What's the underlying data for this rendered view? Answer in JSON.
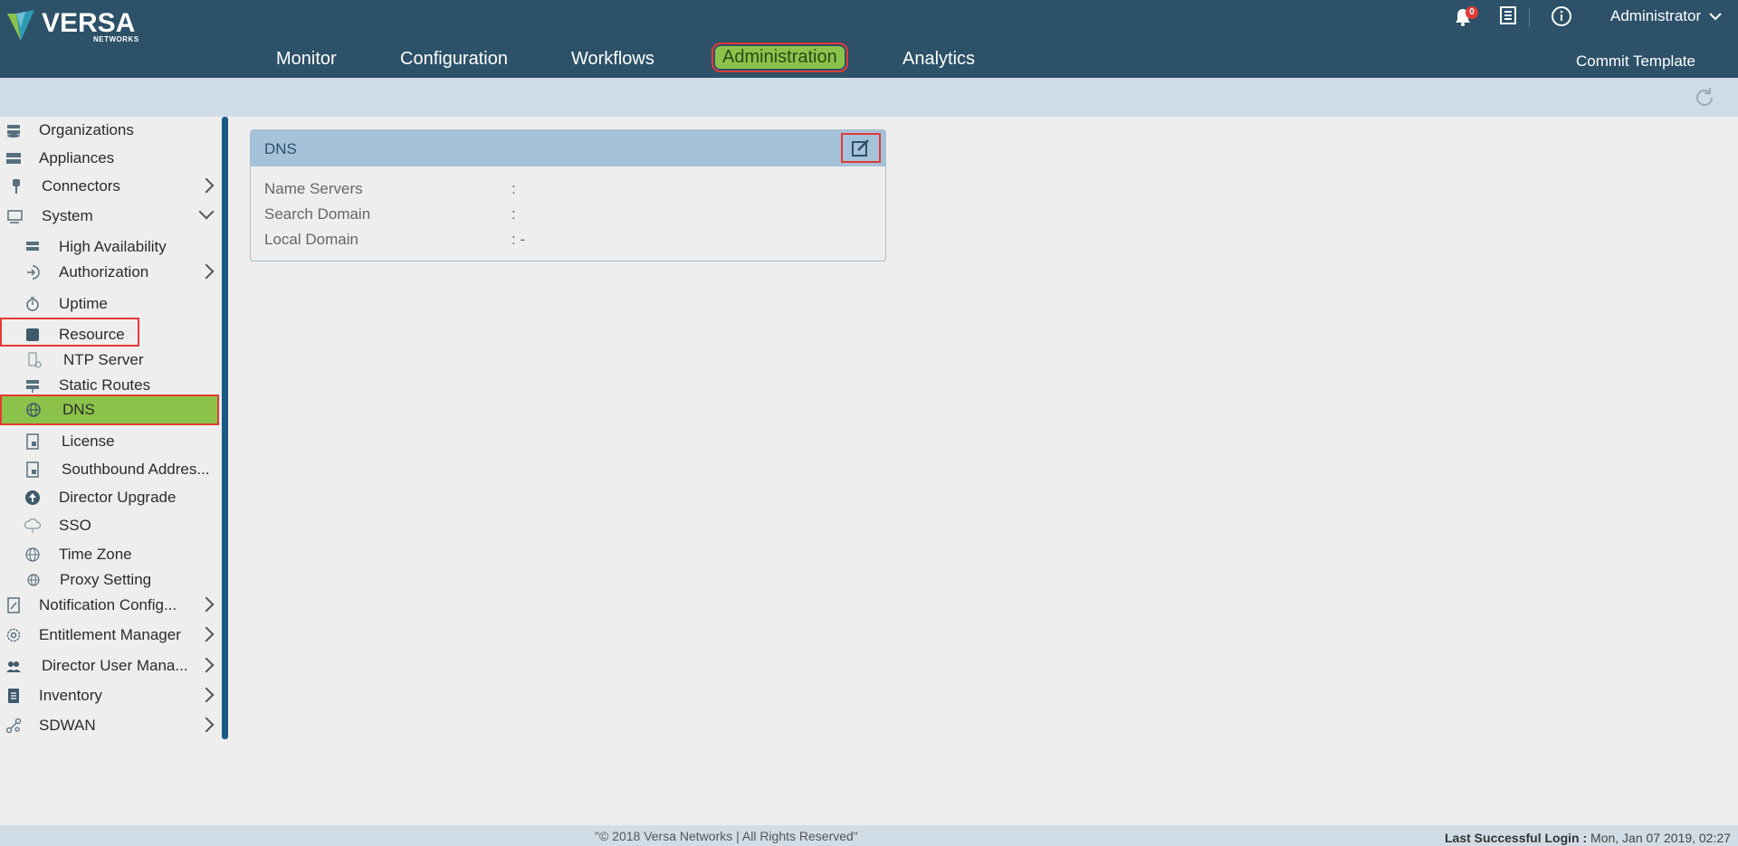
{
  "brand": {
    "name": "VERSA",
    "sub": "NETWORKS"
  },
  "nav": {
    "items": [
      {
        "label": "Monitor"
      },
      {
        "label": "Configuration"
      },
      {
        "label": "Workflows"
      },
      {
        "label": "Administration",
        "active": true
      },
      {
        "label": "Analytics"
      }
    ]
  },
  "topbar": {
    "alerts_count": "0",
    "user": "Administrator",
    "commit": "Commit Template"
  },
  "sidebar": {
    "items": [
      {
        "label": "Organizations",
        "icon": "organizations-icon"
      },
      {
        "label": "Appliances",
        "icon": "appliances-icon"
      },
      {
        "label": "Connectors",
        "icon": "connectors-icon"
      },
      {
        "label": "System",
        "icon": "system-icon"
      },
      {
        "label": "High Availability",
        "icon": "high-availability-icon"
      },
      {
        "label": "Authorization",
        "icon": "authorization-icon"
      },
      {
        "label": "Uptime",
        "icon": "uptime-icon"
      },
      {
        "label": "Resource",
        "icon": "resource-icon"
      },
      {
        "label": "NTP Server",
        "icon": "ntp-server-icon"
      },
      {
        "label": "Static Routes",
        "icon": "static-routes-icon"
      },
      {
        "label": "DNS",
        "icon": "dns-icon",
        "selected": true
      },
      {
        "label": "License",
        "icon": "license-icon"
      },
      {
        "label": "Southbound Addres...",
        "icon": "southbound-address-icon"
      },
      {
        "label": "Director Upgrade",
        "icon": "director-upgrade-icon"
      },
      {
        "label": "SSO",
        "icon": "sso-icon"
      },
      {
        "label": "Time Zone",
        "icon": "time-zone-icon"
      },
      {
        "label": "Proxy Setting",
        "icon": "proxy-setting-icon"
      },
      {
        "label": "Notification Config...",
        "icon": "notification-config-icon"
      },
      {
        "label": "Entitlement Manager",
        "icon": "entitlement-manager-icon"
      },
      {
        "label": "Director User Mana...",
        "icon": "director-user-management-icon"
      },
      {
        "label": "Inventory",
        "icon": "inventory-icon"
      },
      {
        "label": "SDWAN",
        "icon": "sdwan-icon"
      }
    ]
  },
  "dns_card": {
    "title": "DNS",
    "fields": [
      {
        "label": "Name Servers",
        "value": ":"
      },
      {
        "label": "Search Domain",
        "value": ":"
      },
      {
        "label": "Local Domain",
        "value": ": -"
      }
    ]
  },
  "footer": {
    "copyright": "\"© 2018 Versa Networks | All Rights Reserved\"",
    "last_login_label": "Last Successful Login :",
    "last_login_value": "Mon, Jan 07 2019, 02:27"
  },
  "colors": {
    "header_bg": "#2c5169",
    "accent_green": "#8bc34a",
    "highlight_red": "#e53935",
    "sidebar_bar": "#1c5a86"
  }
}
